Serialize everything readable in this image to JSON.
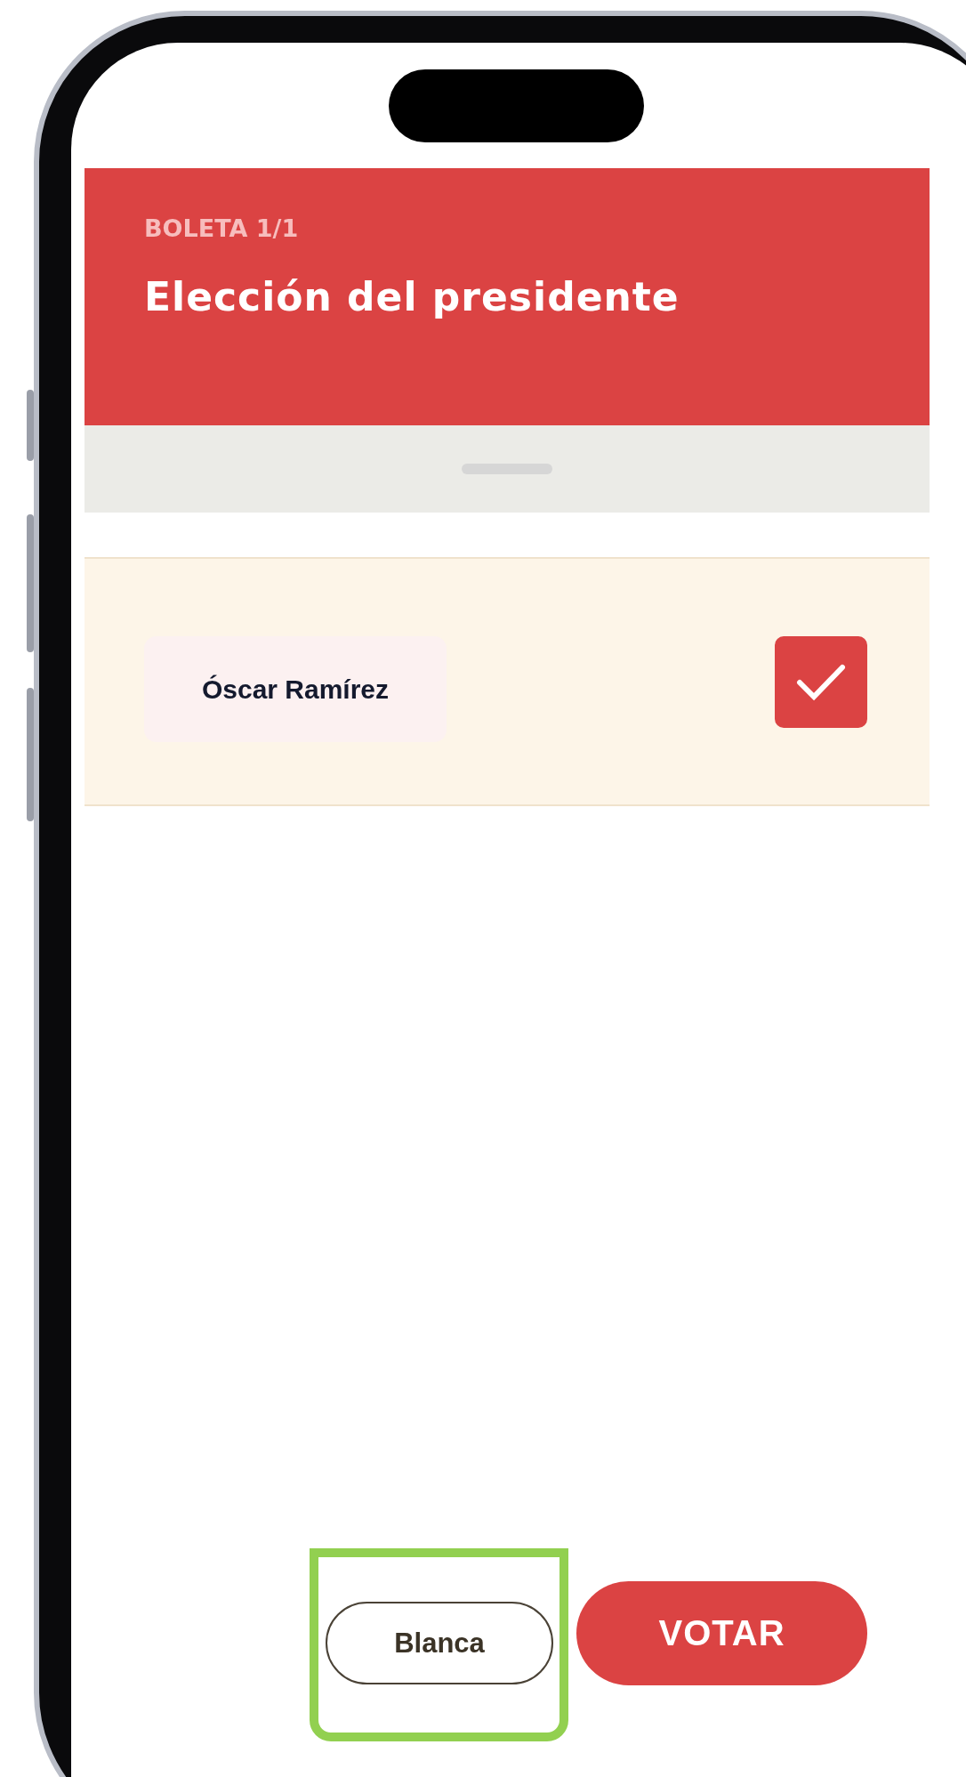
{
  "header": {
    "ballot_label": "BOLETA 1/1",
    "title": "Elección del presidente"
  },
  "candidates": [
    {
      "name": "Óscar Ramírez",
      "selected": true
    }
  ],
  "buttons": [
    {
      "label": "Blanca",
      "kind": "outline",
      "highlighted": true
    },
    {
      "label": "VOTAR",
      "kind": "primary",
      "highlighted": false
    }
  ]
}
